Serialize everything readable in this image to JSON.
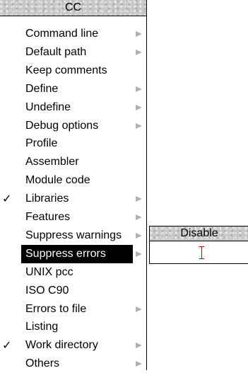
{
  "menu": {
    "title": "CC",
    "items": [
      {
        "label": "Command line",
        "submenu": true,
        "checked": false
      },
      {
        "label": "Default path",
        "submenu": true,
        "checked": false
      },
      {
        "label": "Keep comments",
        "submenu": false,
        "checked": false
      },
      {
        "label": "Define",
        "submenu": true,
        "checked": false
      },
      {
        "label": "Undefine",
        "submenu": true,
        "checked": false
      },
      {
        "label": "Debug options",
        "submenu": true,
        "checked": false
      },
      {
        "label": "Profile",
        "submenu": false,
        "checked": false
      },
      {
        "label": "Assembler",
        "submenu": false,
        "checked": false
      },
      {
        "label": "Module code",
        "submenu": false,
        "checked": false
      },
      {
        "label": "Libraries",
        "submenu": true,
        "checked": true
      },
      {
        "label": "Features",
        "submenu": true,
        "checked": false
      },
      {
        "label": "Suppress warnings",
        "submenu": true,
        "checked": false
      },
      {
        "label": "Suppress errors",
        "submenu": true,
        "checked": false,
        "selected": true
      },
      {
        "label": "UNIX pcc",
        "submenu": false,
        "checked": false
      },
      {
        "label": "ISO C90",
        "submenu": false,
        "checked": false
      },
      {
        "label": "Errors to file",
        "submenu": true,
        "checked": false
      },
      {
        "label": "Listing",
        "submenu": false,
        "checked": false
      },
      {
        "label": "Work directory",
        "submenu": true,
        "checked": true
      },
      {
        "label": "Others",
        "submenu": true,
        "checked": false
      }
    ]
  },
  "submenu": {
    "title": "Disable",
    "field_value": ""
  },
  "icons": {
    "check": "✓",
    "submenu_arrow": "submenu-arrow-icon"
  },
  "colors": {
    "title_bar": "#c8c8c8",
    "selection_bg": "#000000",
    "selection_fg": "#ffffff",
    "arrow": "#b0b0b0",
    "caret": "#c00000"
  }
}
